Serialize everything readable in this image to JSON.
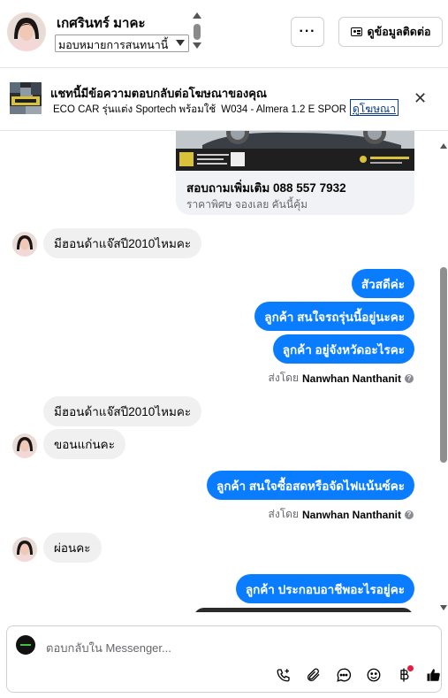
{
  "header": {
    "contact_name": "เกศรินทร์ มาคะ",
    "assign_select": "มอบหมายการสนทนานี้",
    "more_label": "···",
    "contact_info_label": "ดูข้อมูลติดต่อ"
  },
  "ad_banner": {
    "title": "แชทนี้มีข้อความตอบกลับต่อโฆษณาของคุณ",
    "subtitle": "ECO CAR รุ่นแต่ง Sportech พร้อมใช้",
    "subtitle_more": "W034 - Almera 1.2 E SPOR...",
    "link_label": "ดูโฆษณา",
    "close_label": "✕"
  },
  "product_card": {
    "title": "สอบถามเพิ่มเติม 088 557 7932",
    "subtitle": "ราคาพิศษ จองเลย คันนี้คุ้ม"
  },
  "messages": {
    "m1": "มีฮอนด้าแจ๊สปี2010ไหมคะ",
    "m2": "สัวสดีค่ะ",
    "m3": "ลูกค้า สนใจรถรุ่นนี้อยู่นะคะ",
    "m4": "ลูกค้า อยู่จังหวัดอะไรคะ",
    "m5": "มีฮอนด้าแจ๊สปี2010ไหมคะ",
    "m6": "ขอนแก่นคะ",
    "m7": "ลูกค้า สนใจซื้อสดหรือจัดไฟแน้นซ์คะ",
    "m8": "ผ่อนคะ",
    "m9": "ลูกค้า ประกอบอาชีพอะไรอยู่คะ"
  },
  "sent_by": {
    "prefix": "ส่งโดย",
    "name": "Nanwhan Nanthanit"
  },
  "composer": {
    "placeholder": "ตอบกลับใน Messenger..."
  },
  "colors": {
    "outgoing_bubble": "#0a7cff",
    "incoming_bubble": "#f0f0f0",
    "notification_dot": "#e41e3f"
  }
}
